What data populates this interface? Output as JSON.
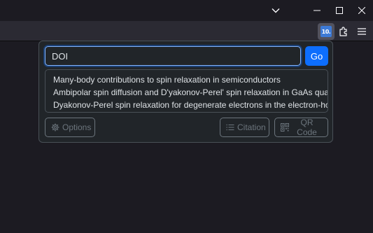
{
  "window_controls": {
    "list_tabs_icon": "chevron-down-icon",
    "minimize_icon": "minimize-icon",
    "maximize_icon": "maximize-icon",
    "close_icon": "close-icon"
  },
  "toolbar": {
    "extension_badge": "10.",
    "extensions_icon": "puzzle-icon",
    "menu_icon": "hamburger-menu-icon"
  },
  "popup": {
    "input_value": "DOI",
    "go_label": "Go",
    "results": [
      "Many-body contributions to spin relaxation in semiconductors",
      "Ambipolar spin diffusion and D'yakonov-Perel' spin relaxation in GaAs quantum wells",
      "Dyakonov-Perel spin relaxation for degenerate electrons in the electron-hole liquid"
    ],
    "options_label": "Options",
    "citation_label": "Citation",
    "qr_label": "QR Code"
  },
  "colors": {
    "accent": "#0d6efd",
    "popup_bg": "#212529",
    "toolbar_bg": "#2b2a33",
    "window_bg": "#1c1b22"
  }
}
